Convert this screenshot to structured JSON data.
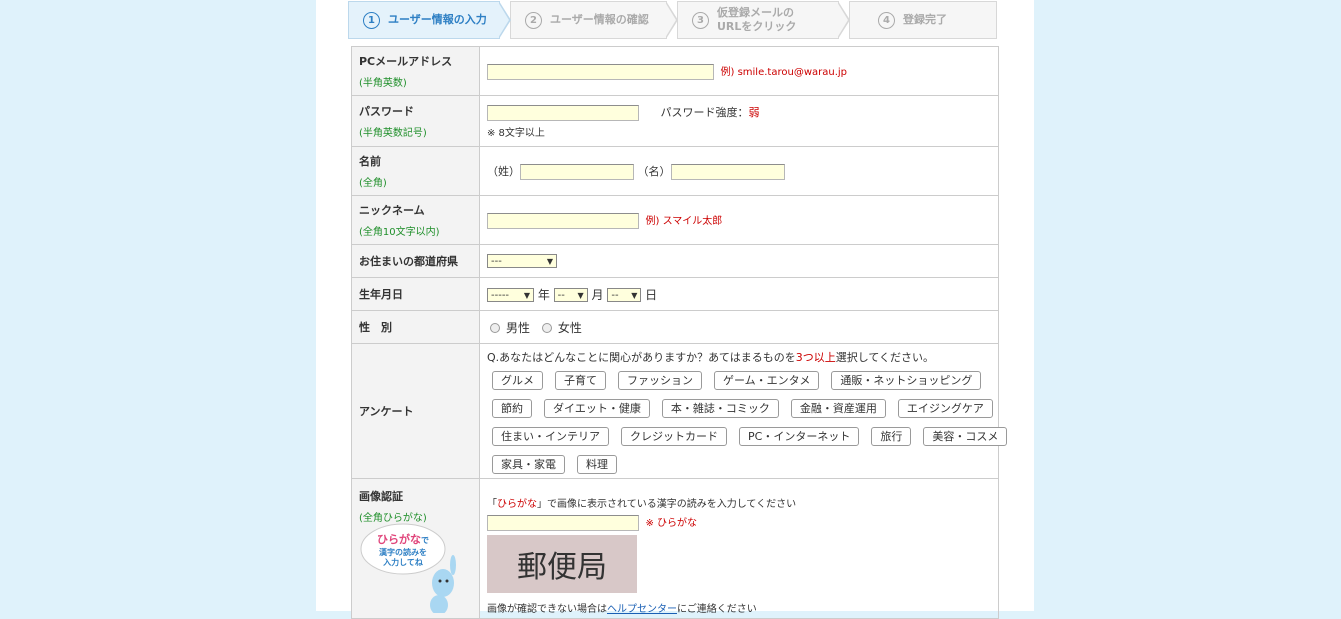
{
  "steps": [
    {
      "num": "1",
      "label": "ユーザー情報の入力",
      "active": true
    },
    {
      "num": "2",
      "label": "ユーザー情報の確認",
      "active": false
    },
    {
      "num": "3",
      "label1": "仮登録メールの",
      "label2": "URLをクリック",
      "active": false
    },
    {
      "num": "4",
      "label": "登録完了",
      "active": false
    }
  ],
  "email": {
    "label": "PCメールアドレス",
    "sub": "(半角英数)",
    "example": "例) smile.tarou@warau.jp",
    "value": ""
  },
  "password": {
    "label": "パスワード",
    "sub": "(半角英数記号)",
    "strength_label": "パスワード強度：",
    "strength_value": "弱",
    "note": "※ 8文字以上",
    "value": ""
  },
  "name": {
    "label": "名前",
    "sub": "(全角)",
    "sei": "（姓）",
    "mei": "（名）"
  },
  "nickname": {
    "label": "ニックネーム",
    "sub": "(全角10文字以内)",
    "example": "例) スマイル太郎"
  },
  "prefecture": {
    "label": "お住まいの都道府県",
    "selected": "---"
  },
  "birthday": {
    "label": "生年月日",
    "year": "-----",
    "year_unit": "年",
    "month": "--",
    "month_unit": "月",
    "day": "--",
    "day_unit": "日"
  },
  "gender": {
    "label": "性　別",
    "male": "男性",
    "female": "女性"
  },
  "survey": {
    "label": "アンケート",
    "question_pre": "Q.あなたはどんなことに関心がありますか？あてはまるものを",
    "question_em": "3つ以上",
    "question_post": "選択してください。",
    "rows": [
      [
        "グルメ",
        "子育て",
        "ファッション",
        "ゲーム・エンタメ",
        "通販・ネットショッピング"
      ],
      [
        "節約",
        "ダイエット・健康",
        "本・雑誌・コミック",
        "金融・資産運用",
        "エイジングケア"
      ],
      [
        "住まい・インテリア",
        "クレジットカード",
        "PC・インターネット",
        "旅行",
        "美容・コスメ"
      ],
      [
        "家具・家電",
        "料理"
      ]
    ]
  },
  "captcha": {
    "label": "画像認証",
    "sub": "(全角ひらがな)",
    "instruction_q1": "「",
    "instruction_em": "ひらがな",
    "instruction_q2": "」で画像に表示されている漢字の読みを入力してください",
    "input_note": "※ ひらがな",
    "image_text": "郵便局",
    "help_pre": "画像が確認できない場合は",
    "help_link": "ヘルプセンター",
    "help_post": "にご連絡ください",
    "mascot_line1": "ひらがな",
    "mascot_line1b": "で",
    "mascot_line2": "漢字の読みを",
    "mascot_line3": "入力してね"
  }
}
